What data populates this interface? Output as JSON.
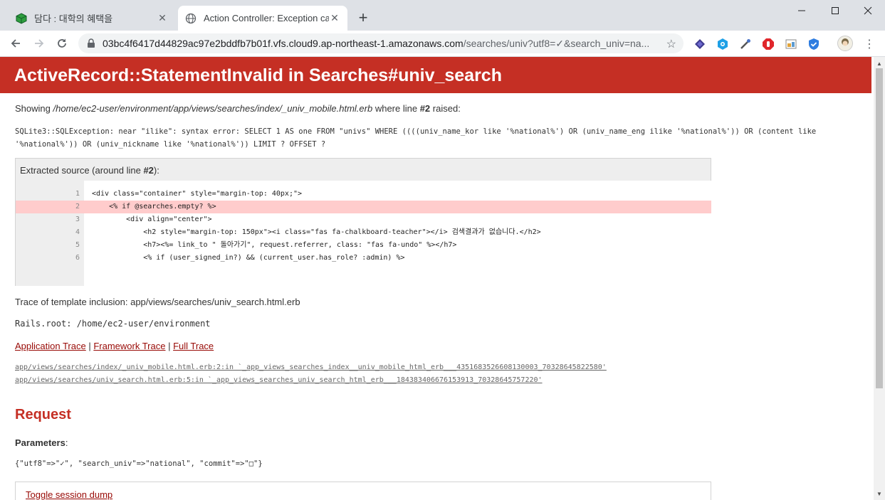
{
  "browser": {
    "tabs": [
      {
        "title": "담다 : 대학의 혜택을",
        "active": false,
        "icon": "green-cube-icon"
      },
      {
        "title": "Action Controller: Exception cau",
        "active": true,
        "icon": "globe-icon"
      }
    ],
    "url_host": "03bc4f6417d44829ac97e2bddfb7b01f.vfs.cloud9.ap-northeast-1.amazonaws.com",
    "url_path": "/searches/univ?utf8=✓&search_univ=na...",
    "extensions": [
      "layers-icon",
      "eye-icon",
      "eyedropper-icon",
      "adblock-icon",
      "image-icon",
      "shield-icon",
      "avatar"
    ]
  },
  "page": {
    "title": "ActiveRecord::StatementInvalid in Searches#univ_search",
    "showing_prefix": "Showing ",
    "showing_path": "/home/ec2-user/environment/app/views/searches/index/_univ_mobile.html.erb",
    "showing_mid": " where line ",
    "showing_line": "#2",
    "showing_suffix": " raised:",
    "error_message": "SQLite3::SQLException: near \"ilike\": syntax error: SELECT  1 AS one FROM \"univs\" WHERE ((((univ_name_kor like '%national%') OR (univ_name_eng ilike '%national%')) OR (content like '%national%')) OR (univ_nickname like '%national%')) LIMIT ? OFFSET ?",
    "source_label_prefix": "Extracted source (around line ",
    "source_label_line": "#2",
    "source_label_suffix": "):",
    "source_lines": [
      {
        "n": "1",
        "code": "<div class=\"container\" style=\"margin-top: 40px;\">"
      },
      {
        "n": "2",
        "code": "    <% if @searches.empty? %>"
      },
      {
        "n": "3",
        "code": "        <div align=\"center\">"
      },
      {
        "n": "4",
        "code": "            <h2 style=\"margin-top: 150px\"><i class=\"fas fa-chalkboard-teacher\"></i> 검색결과가 없습니다.</h2>"
      },
      {
        "n": "5",
        "code": "            <h7><%= link_to \" 돌아가기\", request.referrer, class: \"fas fa-undo\" %></h7>"
      },
      {
        "n": "6",
        "code": "            <% if (user_signed_in?) && (current_user.has_role? :admin) %>"
      }
    ],
    "highlight_line": 2,
    "trace_inclusion": "Trace of template inclusion: app/views/searches/univ_search.html.erb",
    "rails_root": "Rails.root: /home/ec2-user/environment",
    "trace_links": [
      "Application Trace",
      "Framework Trace",
      "Full Trace"
    ],
    "trace_sep": " | ",
    "trace_lines": [
      "app/views/searches/index/_univ_mobile.html.erb:2:in `_app_views_searches_index__univ_mobile_html_erb___4351683526608130003_70328645822580'",
      "app/views/searches/univ_search.html.erb:5:in `_app_views_searches_univ_search_html_erb___184383406676153913_70328645757220'"
    ],
    "request_heading": "Request",
    "parameters_label": "Parameters",
    "parameters_colon": ":",
    "parameters_value": "{\"utf8\"=>\"✓\", \"search_univ\"=>\"national\", \"commit\"=>\"□\"}",
    "toggle_session": "Toggle session dump"
  },
  "colors": {
    "header_red": "#c52f24",
    "link": "#980905",
    "highlight": "#ffcccc"
  }
}
